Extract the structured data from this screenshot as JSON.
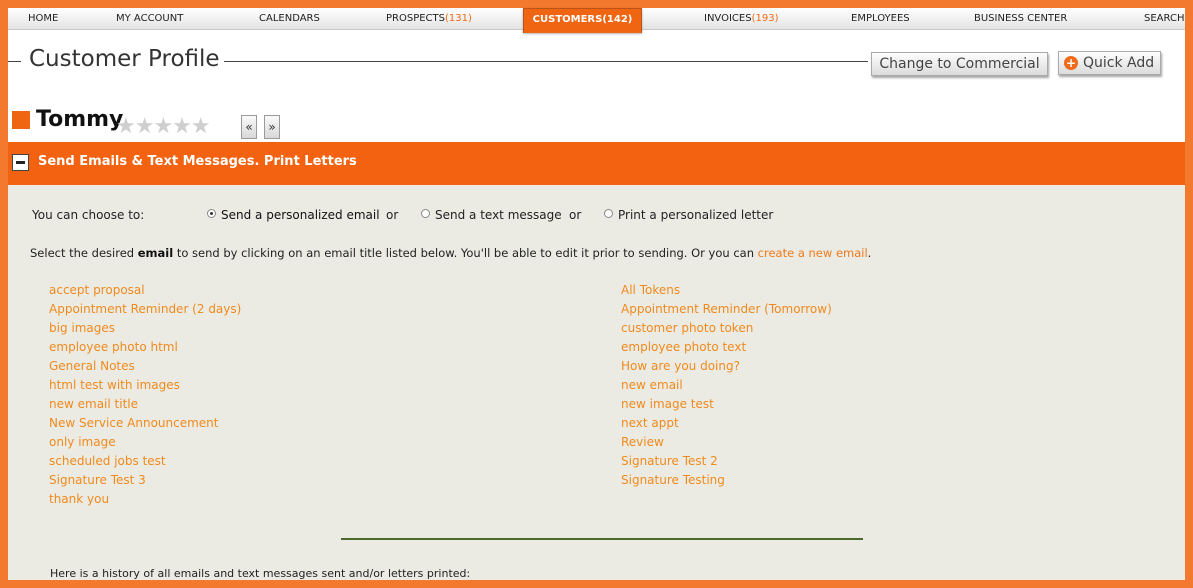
{
  "nav": [
    {
      "label": "HOME",
      "count": ""
    },
    {
      "label": "MY ACCOUNT",
      "count": ""
    },
    {
      "label": "CALENDARS",
      "count": ""
    },
    {
      "label": "PROSPECTS",
      "count": "(131)"
    },
    {
      "label": "CUSTOMERS",
      "count": "(142)"
    },
    {
      "label": "INVOICES",
      "count": "(193)"
    },
    {
      "label": "EMPLOYEES",
      "count": ""
    },
    {
      "label": "BUSINESS CENTER",
      "count": ""
    },
    {
      "label": "SEARCH",
      "count": ""
    }
  ],
  "header": {
    "title": "Customer Profile",
    "commercial_button": "Change to Commercial",
    "quick_add_button": "Quick Add",
    "plus_icon": "+"
  },
  "customer": {
    "name": "Tommy",
    "stars": "★★★★★",
    "rating": 0,
    "prev": "«",
    "next": "»"
  },
  "section": {
    "title": "Send Emails & Text Messages. Print Letters"
  },
  "options": {
    "choose_label": "You can choose to:",
    "email": "Send a personalized email",
    "text": "Send a text message",
    "letter": "Print a personalized letter",
    "or": "or",
    "selected": "email"
  },
  "instructions": {
    "prefix": "Select the desired ",
    "emphasis": "email",
    "middle": " to send by clicking on an email title listed below. You'll be able to edit it prior to sending. Or you can ",
    "link": "create a new email",
    "suffix": "."
  },
  "emails_left": [
    "accept proposal",
    "Appointment Reminder (2 days)",
    "big images",
    "employee photo html",
    "General Notes",
    "html test with images",
    "new email title",
    "New Service Announcement",
    "only image",
    "scheduled jobs test",
    "Signature Test 3",
    "thank you"
  ],
  "emails_right": [
    "All Tokens",
    "Appointment Reminder (Tomorrow)",
    "customer photo token",
    "employee photo text",
    "How are you doing?",
    "new email",
    "new image test",
    "next appt",
    "Review",
    "Signature Test 2",
    "Signature Testing"
  ],
  "history_label": "Here is a history of all emails and text messages sent and/or letters printed:",
  "colors": {
    "accent": "#f26210",
    "link": "#f08a1c",
    "frame": "#f2792d"
  }
}
